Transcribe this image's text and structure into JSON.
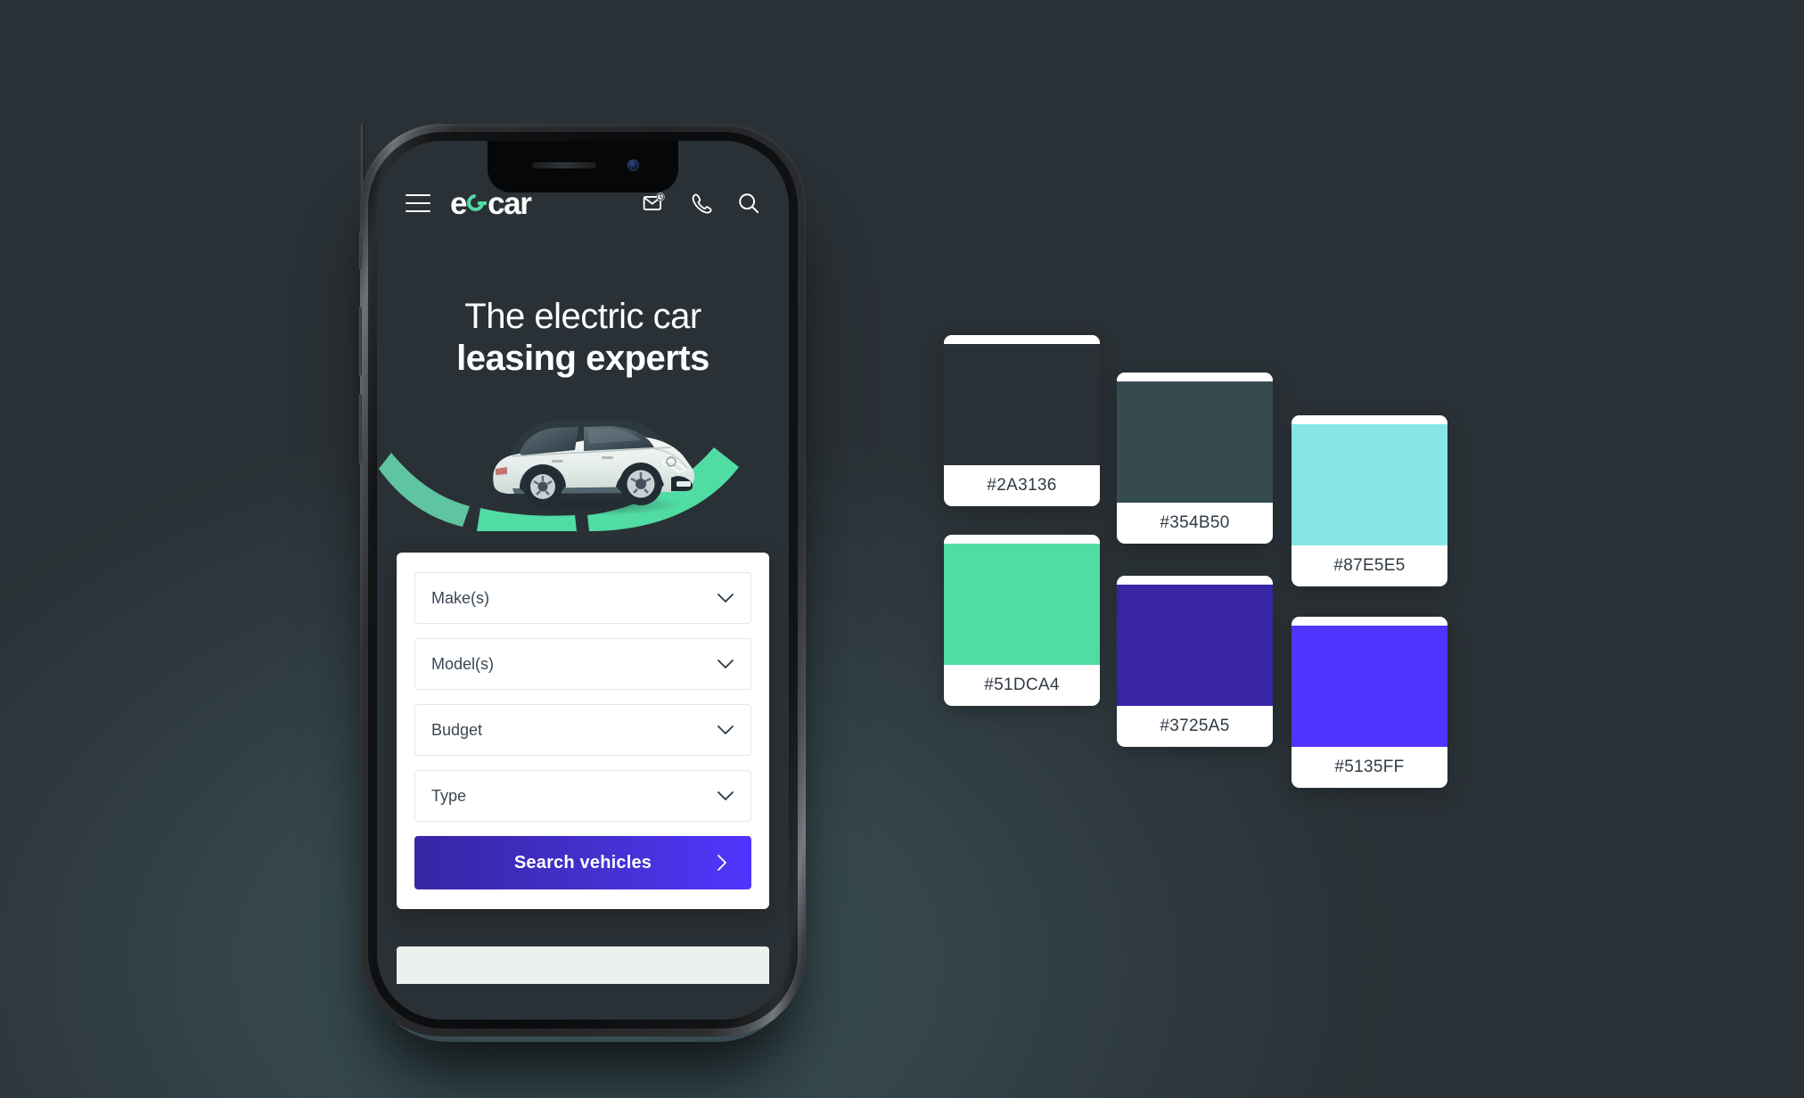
{
  "background": {
    "base_color": "#2A3136",
    "glow_color": "#354B50"
  },
  "phone": {
    "device": "smartphone-mockup",
    "app": {
      "header": {
        "menu_icon": "hamburger-menu-icon",
        "logo": {
          "text_before": "e",
          "plug_icon": "plug-icon",
          "text_after": "car",
          "accent_color": "#51DCA4"
        },
        "icons": [
          {
            "name": "mail-icon",
            "label": "Email"
          },
          {
            "name": "phone-icon",
            "label": "Call"
          },
          {
            "name": "search-icon",
            "label": "Search"
          }
        ]
      },
      "hero": {
        "headline_line1": "The electric car",
        "headline_line2": "leasing experts",
        "illustration": "white-electric-car-on-green-arcs"
      },
      "search_form": {
        "fields": [
          {
            "name": "make",
            "label": "Make(s)",
            "placeholder": "Make(s)",
            "value": "",
            "chevron": "chevron-down-icon"
          },
          {
            "name": "model",
            "label": "Model(s)",
            "placeholder": "Model(s)",
            "value": "",
            "chevron": "chevron-down-icon"
          },
          {
            "name": "budget",
            "label": "Budget",
            "placeholder": "Budget",
            "value": "",
            "chevron": "chevron-down-icon"
          },
          {
            "name": "type",
            "label": "Type",
            "placeholder": "Type",
            "value": "",
            "chevron": "chevron-down-icon"
          }
        ],
        "submit": {
          "label": "Search vehicles",
          "arrow_icon": "chevron-right-icon",
          "gradient_from": "#3725A5",
          "gradient_to": "#5135FF"
        }
      }
    }
  },
  "palette": {
    "title": "",
    "swatches": [
      {
        "hex": "#2A3136",
        "name": "swatch-dark-slate",
        "col": 0,
        "row": 0
      },
      {
        "hex": "#51DCA4",
        "name": "swatch-mint-green",
        "col": 0,
        "row": 1
      },
      {
        "hex": "#354B50",
        "name": "swatch-deep-teal",
        "col": 1,
        "row": 0
      },
      {
        "hex": "#3725A5",
        "name": "swatch-deep-purple",
        "col": 1,
        "row": 1
      },
      {
        "hex": "#87E5E5",
        "name": "swatch-light-cyan",
        "col": 2,
        "row": 0
      },
      {
        "hex": "#5135FF",
        "name": "swatch-violet",
        "col": 2,
        "row": 1
      }
    ]
  }
}
